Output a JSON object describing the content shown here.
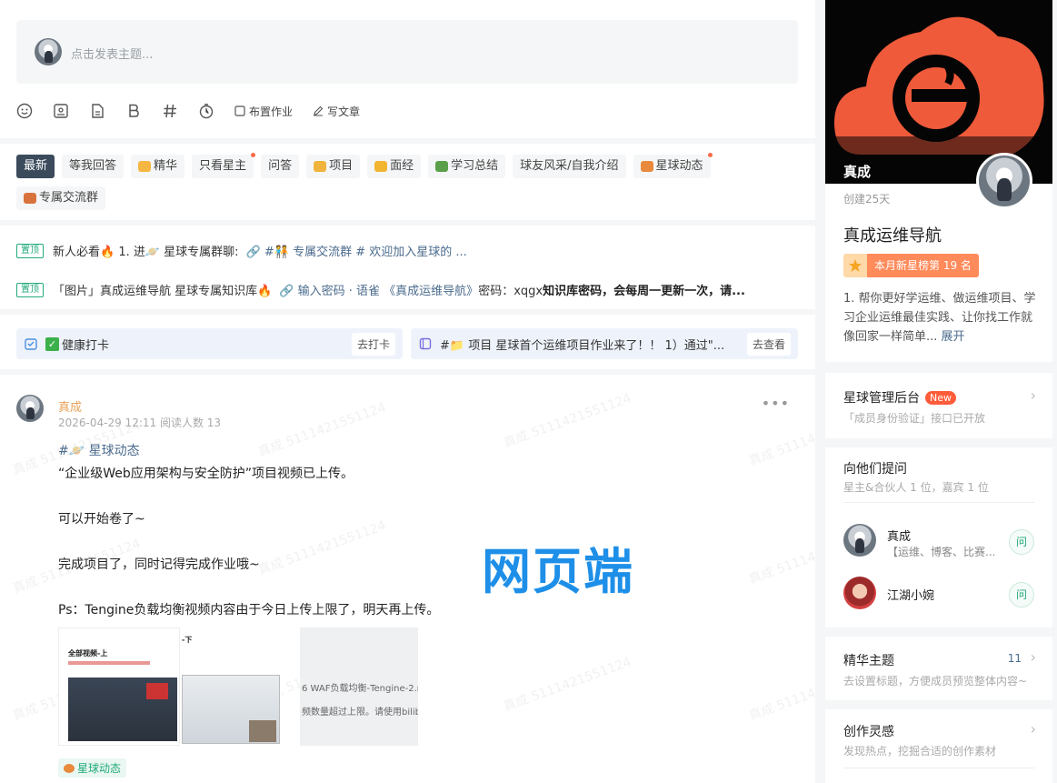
{
  "composer": {
    "placeholder": "点击发表主题...",
    "assign_homework": "布置作业",
    "write_article": "写文章"
  },
  "tabs": {
    "row1": [
      {
        "label": "最新",
        "active": true,
        "dot": false,
        "emoji": ""
      },
      {
        "label": "等我回答",
        "active": false,
        "dot": false,
        "emoji": ""
      },
      {
        "label": "精华",
        "active": false,
        "dot": false,
        "emoji": "#f5b642"
      },
      {
        "label": "只看星主",
        "active": false,
        "dot": true,
        "emoji": ""
      },
      {
        "label": "问答",
        "active": false,
        "dot": false,
        "emoji": ""
      },
      {
        "label": "项目",
        "active": false,
        "dot": false,
        "emoji": "#f0b43c"
      },
      {
        "label": "面经",
        "active": false,
        "dot": false,
        "emoji": "#f2b530"
      },
      {
        "label": "学习总结",
        "active": false,
        "dot": false,
        "emoji": "#5aa04a"
      },
      {
        "label": "球友风采/自我介绍",
        "active": false,
        "dot": false,
        "emoji": ""
      },
      {
        "label": "星球动态",
        "active": false,
        "dot": true,
        "emoji": "#e8893c"
      }
    ],
    "row2": [
      {
        "label": "专属交流群",
        "emoji": "#d9733d"
      }
    ]
  },
  "pinned": [
    {
      "tag": "置顶",
      "text": "新人必看🔥 1. 进🪐 星球专属群聊:",
      "link": "🔗 #🧑‍🤝‍🧑 专属交流群 # 欢迎加入星球的 ..."
    },
    {
      "tag": "置顶",
      "text": "「图片」真成运维导航 星球专属知识库🔥",
      "link": "🔗 输入密码 · 语雀 《真成运维导航》",
      "tail_plain": " 密码：xqgx ",
      "tail_bold": "知识库密码，会每周一更新一次，请..."
    }
  ],
  "checkins": {
    "left_label": "健康打卡",
    "left_button": "去打卡",
    "right_label": "#📁 项目  星球首个运维项目作业来了！！ 1）通过\"...",
    "right_button": "去查看"
  },
  "post": {
    "author": "真成",
    "meta": "2026-04-29 12:11  阅读人数 13",
    "hashtag": "#🪐 星球动态",
    "lines": [
      "“企业级Web应用架构与安全防护”项目视频已上传。",
      "",
      "可以开始卷了~",
      "",
      "完成项目了，同时记得完成作业哦~",
      "",
      "Ps：Tengine负载均衡视频内容由于今日上传上限了，明天再上传。"
    ],
    "thumb1_title": "全部视频-上",
    "thumb2_title": "-下",
    "thumb3_text1": "6 WAF负载均衡-Tengine-2.mp",
    "thumb3_text2": "频数量超过上限。请使用bilibili",
    "chip": "星球动态",
    "overlay_label": "网页端",
    "watermark": "真成 5111421551124"
  },
  "side": {
    "cover_name": "真成",
    "created": "创建25天",
    "group_name": "真成运维导航",
    "rank": "本月新星榜第 19 名",
    "desc": "1. 帮你更好学运维、做运维项目、学习企业运维最佳实践、让你找工作就像回家一样简单...",
    "desc_more": "展开",
    "admin_title": "星球管理后台",
    "admin_badge": "New",
    "admin_sub": "「成员身份验证」接口已开放",
    "ask_title": "向他们提问",
    "ask_sub": "星主&合伙人 1 位，嘉宾 1 位",
    "askers": [
      {
        "name": "真成",
        "tags": "【运维、博客、比赛..."
      },
      {
        "name": "江湖小婉",
        "tags": ""
      }
    ],
    "ask_button": "问",
    "essence_title": "精华主题",
    "essence_count": "11",
    "essence_sub": "去设置标题，方便成员预览整体内容~",
    "inspire_title": "创作灵感",
    "inspire_sub": "发现热点，挖掘合适的创作素材"
  },
  "colors": {
    "accent_green": "#22ab79",
    "brand_orange": "#ee5a3a",
    "author_orange": "#e8a35a",
    "overlay_blue": "#1e8fe8"
  }
}
